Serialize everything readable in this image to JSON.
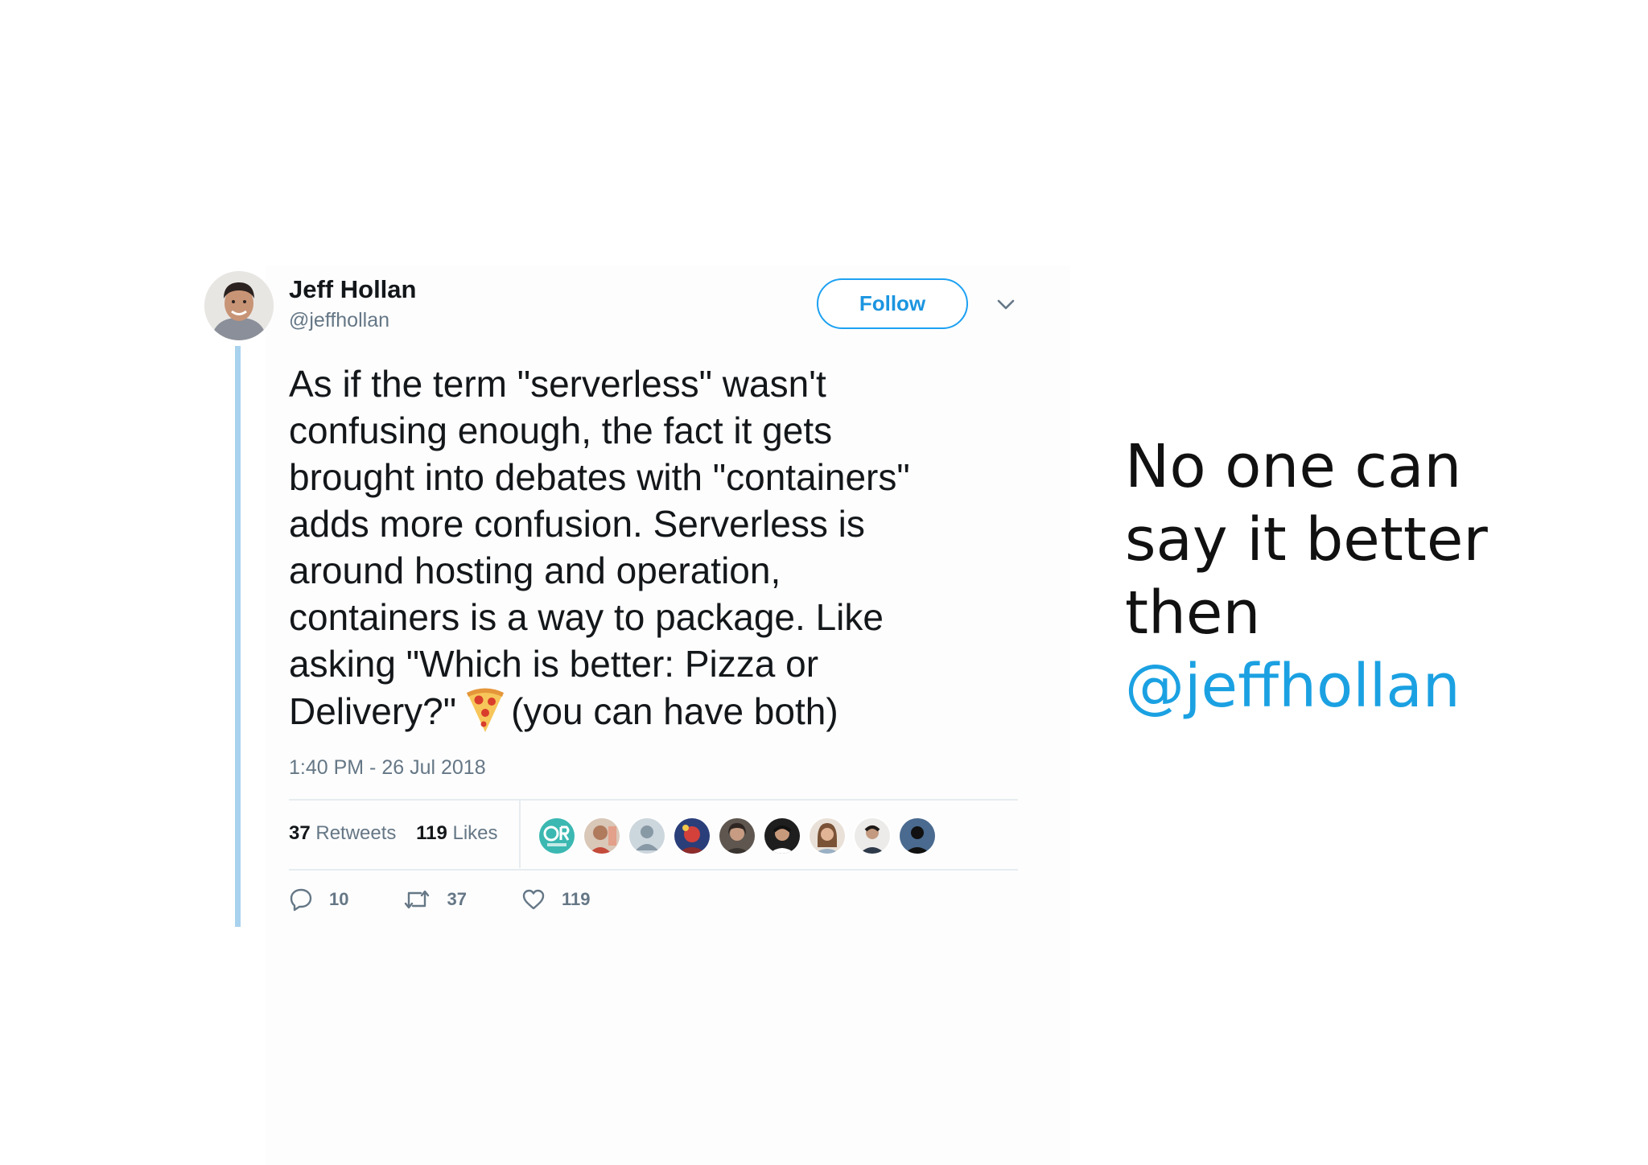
{
  "tweet": {
    "author": {
      "name": "Jeff Hollan",
      "handle": "@jeffhollan"
    },
    "follow_label": "Follow",
    "text": "As if the term \"serverless\" wasn't\nconfusing enough, the fact it gets\nbrought into debates with \"containers\"\nadds more confusion. Serverless is\naround hosting and operation,\ncontainers is a way to package. Like\nasking \"Which is better: Pizza or\nDelivery?\"",
    "text_tail": "(you can have both)",
    "emoji": "pizza",
    "timestamp": "1:40 PM - 26 Jul 2018",
    "stats": {
      "retweets_count": "37",
      "retweets_label": "Retweets",
      "likes_count": "119",
      "likes_label": "Likes"
    },
    "liker_count_shown": 9,
    "actions": {
      "reply_count": "10",
      "retweet_count": "37",
      "like_count": "119"
    },
    "colors": {
      "accent": "#1da1f2",
      "thread_line": "#a9d2ee",
      "muted": "#657786",
      "text": "#14171a"
    }
  },
  "slide": {
    "lines": [
      "No one can",
      "say it better",
      "then"
    ],
    "mention": "@jeffhollan",
    "mention_color": "#1ba1e2"
  },
  "icons": {
    "caret": "chevron-down-icon",
    "reply": "reply-icon",
    "retweet": "retweet-icon",
    "like": "heart-icon"
  }
}
